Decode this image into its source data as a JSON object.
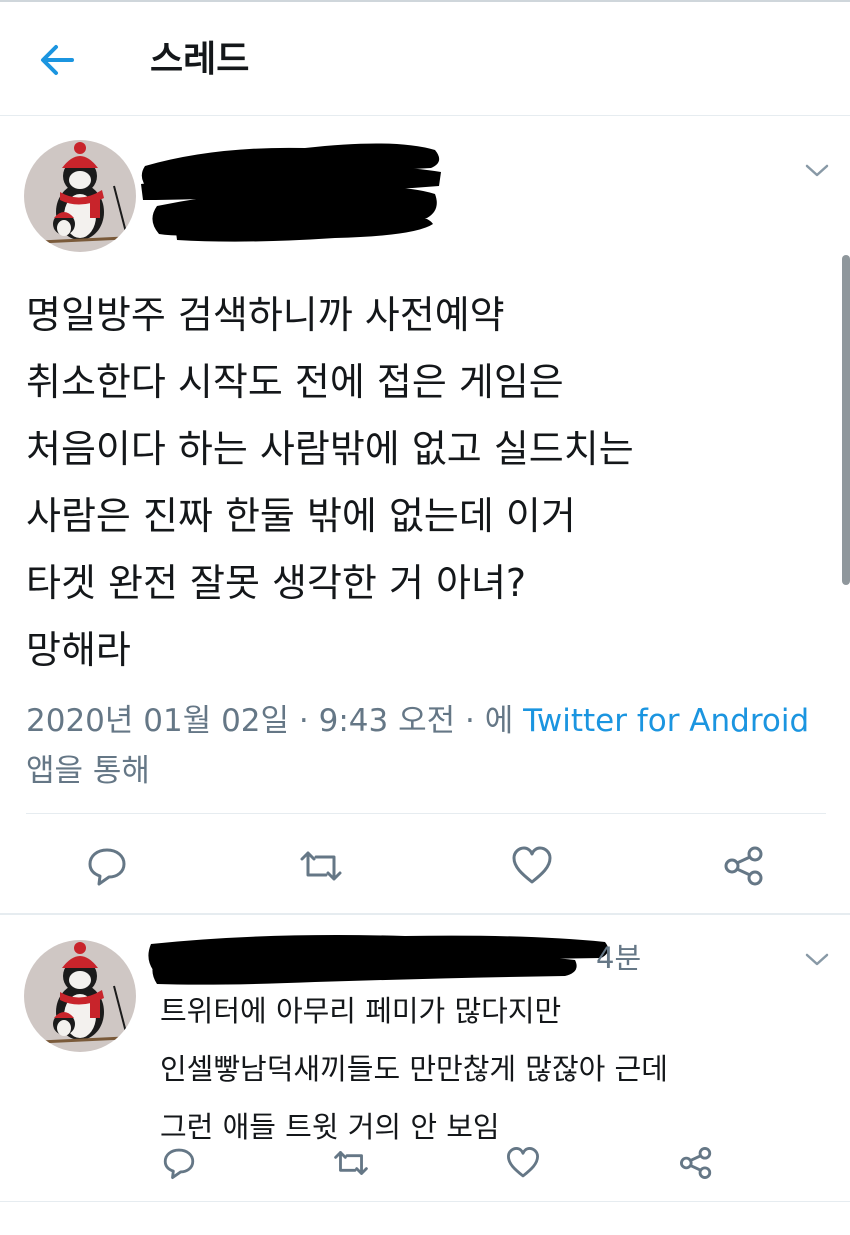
{
  "header": {
    "title": "스레드",
    "back_icon": "arrow-left-icon",
    "accent": "#1b95e0"
  },
  "tweet": {
    "text": "명일방주 검색하니까 사전예약\n취소한다 시작도 전에 접은 게임은\n처음이다 하는 사람밖에 없고 실드치는\n사람은 진짜 한둘 밖에 없는데 이거\n타겟 완전 잘못 생각한 거 아녀?\n망해라",
    "date": "2020년 01월 02일",
    "sep1": " · ",
    "time": "9:43 오전",
    "sep2": " · ",
    "via_prefix": "에 ",
    "client": "Twitter for Android",
    "via_suffix": " 앱을 통해"
  },
  "reply": {
    "time": "4분",
    "text": "트위터에 아무리 페미가 많다지만\n인셀빻남덕새끼들도 만만찮게 많잖아 근데\n그런 애들 트윗 거의 안 보임"
  },
  "icons": {
    "reply": "reply-icon",
    "retweet": "retweet-icon",
    "like": "heart-icon",
    "share": "share-icon",
    "menu": "chevron-down-icon"
  }
}
